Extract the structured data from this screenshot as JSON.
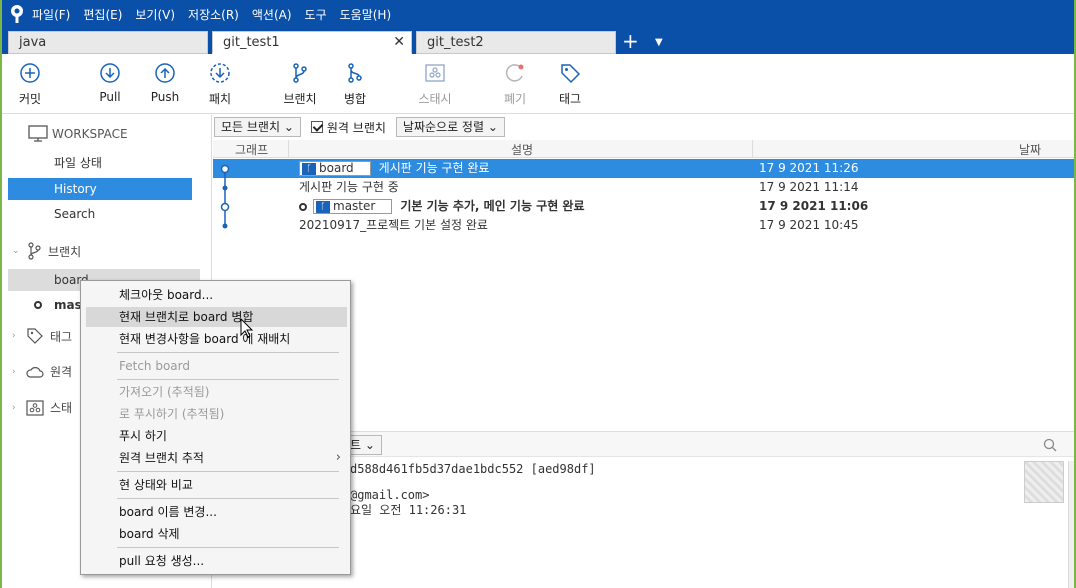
{
  "colors": {
    "accent": "#0a4fa8",
    "selection": "#2d8ce0",
    "frame": "#7ab648"
  },
  "menubar": {
    "logo_icon": "sourcetree-icon",
    "items": [
      "파일(F)",
      "편집(E)",
      "보기(V)",
      "저장소(R)",
      "액션(A)",
      "도구",
      "도움말(H)"
    ]
  },
  "tabs": {
    "items": [
      {
        "label": "java"
      },
      {
        "label": "git_test1",
        "close": "✕"
      },
      {
        "label": "git_test2"
      }
    ],
    "plus": "+",
    "dropdown": "▼"
  },
  "toolbar": {
    "items": [
      {
        "label": "커밋",
        "icon": "plus-circle-icon"
      },
      {
        "label": "Pull",
        "icon": "arrow-down-circle-icon"
      },
      {
        "label": "Push",
        "icon": "arrow-up-circle-icon"
      },
      {
        "label": "패치",
        "icon": "dashed-arrow-down-circle-icon"
      },
      {
        "label": "브랜치",
        "icon": "branch-icon"
      },
      {
        "label": "병합",
        "icon": "merge-icon"
      },
      {
        "label": "스태시",
        "icon": "stash-icon"
      },
      {
        "label": "폐기",
        "icon": "discard-icon"
      },
      {
        "label": "태그",
        "icon": "tag-icon"
      }
    ]
  },
  "sidebar": {
    "workspace": "WORKSPACE",
    "items": [
      "파일 상태",
      "History",
      "Search"
    ],
    "branches_label": "브랜치",
    "branches": [
      "board",
      "master"
    ],
    "sections": [
      "태그",
      "원격",
      "스태"
    ]
  },
  "filter": {
    "all_branches": "모든 브랜치 ⌄",
    "remote_branches": "원격 브랜치",
    "sort": "날짜순으로 정렬 ⌄"
  },
  "table": {
    "headers": {
      "graph": "그래프",
      "description": "설명",
      "date": "날짜"
    },
    "rows": [
      {
        "tag": "board",
        "message": "게시판 기능 구현 완료",
        "date": "17 9 2021 11:26"
      },
      {
        "message": "게시판 기능 구현 중",
        "date": "17 9 2021 11:14"
      },
      {
        "tag": "master",
        "message": "기본 기능 추가, 메인 기능 구현 완료",
        "date": "17 9 2021 11:06"
      },
      {
        "message": "20210917_프로젝트 기본 설정 완료",
        "date": "17 9 2021 10:45"
      }
    ]
  },
  "detail": {
    "dropdown_tail": "트 ⌄",
    "hash": "d588d461fb5d37dae1bdc552 [aed98df]",
    "email": "@gmail.com>",
    "datetime": "요일 오전 11:26:31",
    "search_icon": "search-icon"
  },
  "context_menu": {
    "items": [
      "체크아웃 board...",
      "현재 브랜치로 board 병합",
      "현재 변경사항을 board 에 재배치",
      "Fetch board",
      "가져오기 (추적됨)",
      "로 푸시하기 (추적됨)",
      "푸시 하기",
      "원격 브랜치 추적",
      "현 상태와 비교",
      "board 이름 변경...",
      "board 삭제",
      "pull 요청 생성..."
    ],
    "submenu_arrow": "›"
  }
}
